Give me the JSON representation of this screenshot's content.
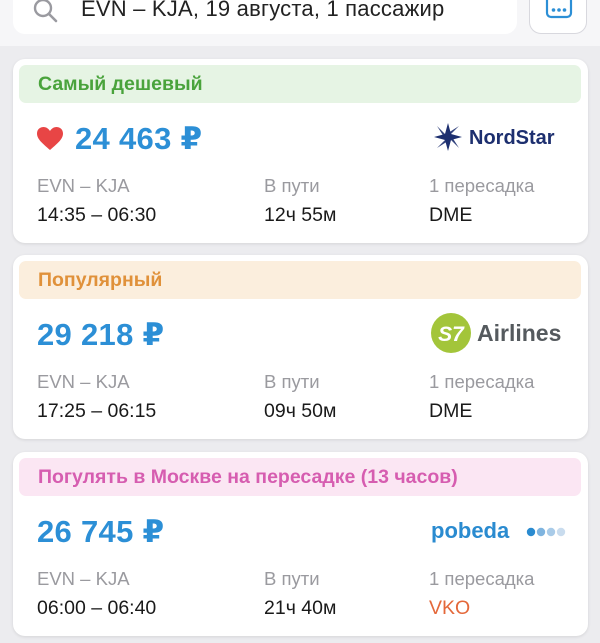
{
  "search": {
    "query": "EVN – KJA, 19 августа, 1 пассажир"
  },
  "labels": {
    "transfer_time": "В пути"
  },
  "colors": {
    "price": "#2c8fd6",
    "cheapest_bg": "#e6f4e4",
    "cheapest_text": "#4aa33c",
    "popular_bg": "#fbeedd",
    "popular_text": "#e0913a",
    "moscow_bg": "#fbe6f3",
    "moscow_text": "#d65db0",
    "highlight_airport": "#e4683a"
  },
  "results": [
    {
      "tag": "Самый дешевый",
      "favorite_icon": "heart-icon",
      "price": "24 463 ₽",
      "airline": "NordStar",
      "route": "EVN – KJA",
      "times": "14:35 – 06:30",
      "duration_label": "В пути",
      "duration": "12ч 55м",
      "stops": "1 пересадка",
      "stop_airport": "DME"
    },
    {
      "tag": "Популярный",
      "price": "29 218 ₽",
      "airline": "Airlines",
      "airline_badge": "S7",
      "route": "EVN – KJA",
      "times": "17:25 – 06:15",
      "duration_label": "В пути",
      "duration": "09ч 50м",
      "stops": "1 пересадка",
      "stop_airport": "DME"
    },
    {
      "tag": "Погулять в Москве на пересадке (13 часов)",
      "price": "26 745 ₽",
      "airline": "pobeda",
      "route": "EVN – KJA",
      "times": "06:00 – 06:40",
      "duration_label": "В пути",
      "duration": "21ч 40м",
      "stops": "1 пересадка",
      "stop_airport": "VKO"
    }
  ]
}
